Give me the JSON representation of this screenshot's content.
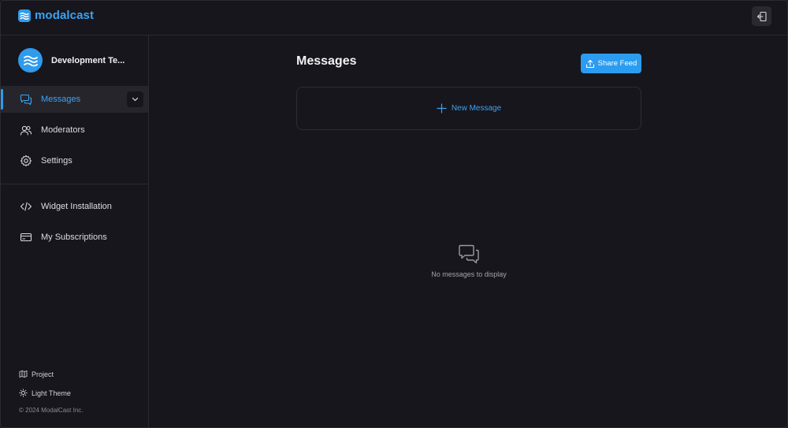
{
  "app": {
    "logo_text": "modalcast"
  },
  "header": {
    "logout_icon": "logout-icon"
  },
  "sidebar": {
    "team_name": "Development Te...",
    "nav": [
      {
        "label": "Messages",
        "icon": "chat-bubbles-icon",
        "active": true
      },
      {
        "label": "Moderators",
        "icon": "users-icon",
        "active": false
      },
      {
        "label": "Settings",
        "icon": "gear-icon",
        "active": false
      },
      {
        "label": "Widget Installation",
        "icon": "code-icon",
        "active": false
      },
      {
        "label": "My Subscriptions",
        "icon": "credit-card-icon",
        "active": false
      }
    ],
    "footer": {
      "project_label": "Project",
      "theme_label": "Light Theme",
      "copyright": "© 2024 ModalCast Inc."
    }
  },
  "main": {
    "title": "Messages",
    "share_label": "Share Feed",
    "new_message_label": "New Message",
    "empty_text": "No messages to display"
  },
  "colors": {
    "accent": "#2f9bec",
    "background": "#17161c",
    "border": "#2b2a31"
  }
}
